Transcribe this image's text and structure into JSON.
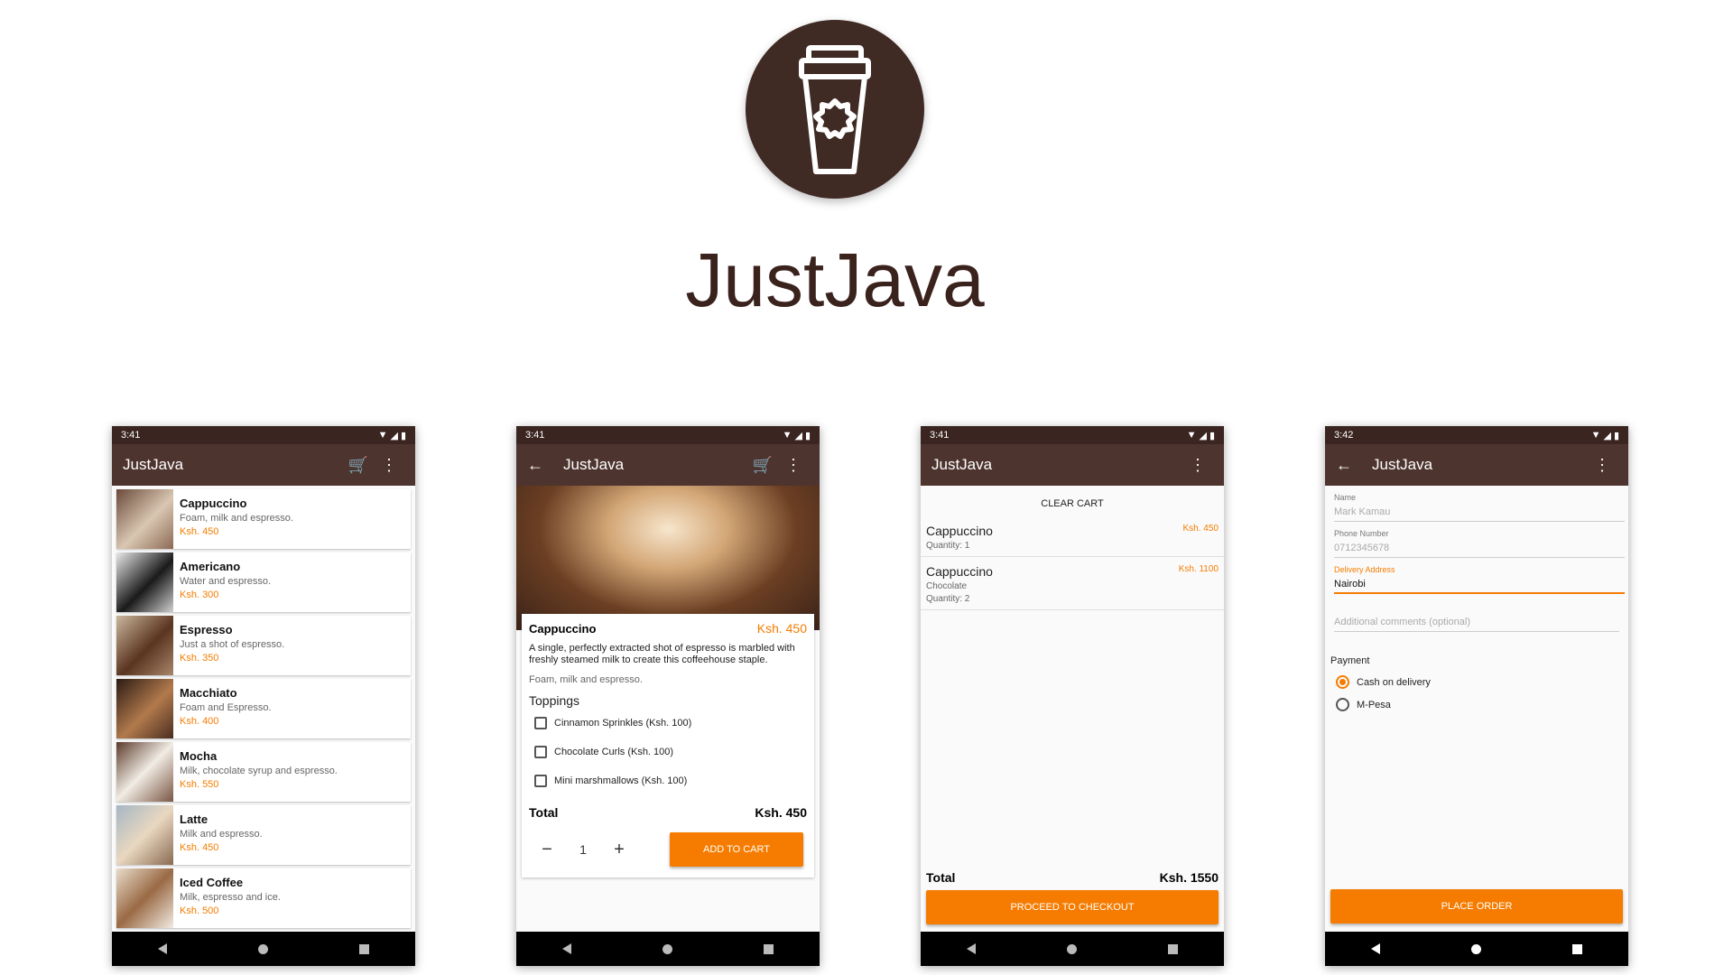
{
  "header": {
    "logo_icon": "coffee-cup-icon",
    "title": "JustJava"
  },
  "colors": {
    "brown_dark": "#3a2520",
    "brown_appbar": "#4e342e",
    "accent": "#f57c00"
  },
  "screens": [
    {
      "time": "3:41",
      "appbar_title": "JustJava",
      "items": [
        {
          "name": "Cappuccino",
          "desc": "Foam, milk and espresso.",
          "price": "Ksh. 450"
        },
        {
          "name": "Americano",
          "desc": "Water and espresso.",
          "price": "Ksh. 300"
        },
        {
          "name": "Espresso",
          "desc": "Just a shot of espresso.",
          "price": "Ksh. 350"
        },
        {
          "name": "Macchiato",
          "desc": "Foam and Espresso.",
          "price": "Ksh. 400"
        },
        {
          "name": "Mocha",
          "desc": "Milk, chocolate syrup and espresso.",
          "price": "Ksh. 550"
        },
        {
          "name": "Latte",
          "desc": "Milk and espresso.",
          "price": "Ksh. 450"
        },
        {
          "name": "Iced Coffee",
          "desc": "Milk, espresso and ice.",
          "price": "Ksh. 500"
        }
      ]
    },
    {
      "time": "3:41",
      "appbar_title": "JustJava",
      "product": {
        "name": "Cappuccino",
        "price": "Ksh. 450",
        "description": "A single, perfectly extracted shot of espresso is marbled with freshly steamed milk to create this coffeehouse staple.",
        "short_desc": "Foam, milk and espresso.",
        "toppings_heading": "Toppings",
        "toppings": [
          "Cinnamon Sprinkles (Ksh. 100)",
          "Chocolate Curls (Ksh. 100)",
          "Mini marshmallows (Ksh. 100)"
        ],
        "total_label": "Total",
        "total_value": "Ksh. 450",
        "minus": "−",
        "quantity": "1",
        "plus": "+",
        "add_to_cart": "ADD TO CART"
      }
    },
    {
      "time": "3:41",
      "appbar_title": "JustJava",
      "clear_cart": "CLEAR CART",
      "cart": [
        {
          "name": "Cappuccino",
          "topping": "",
          "quantity": "Quantity: 1",
          "price": "Ksh. 450"
        },
        {
          "name": "Cappuccino",
          "topping": "Chocolate",
          "quantity": "Quantity: 2",
          "price": "Ksh. 1100"
        }
      ],
      "total_label": "Total",
      "total_value": "Ksh. 1550",
      "checkout": "PROCEED TO CHECKOUT"
    },
    {
      "time": "3:42",
      "appbar_title": "JustJava",
      "fields": [
        {
          "label": "Name",
          "value": "Mark Kamau"
        },
        {
          "label": "Phone Number",
          "value": "0712345678"
        },
        {
          "label": "Delivery Address",
          "value": "Nairobi"
        },
        {
          "label": "",
          "value": "Additional comments (optional)"
        }
      ],
      "payment_heading": "Payment",
      "payment_options": [
        "Cash on delivery",
        "M-Pesa"
      ],
      "payment_selected": "Cash on delivery",
      "place_order": "PLACE ORDER"
    }
  ]
}
